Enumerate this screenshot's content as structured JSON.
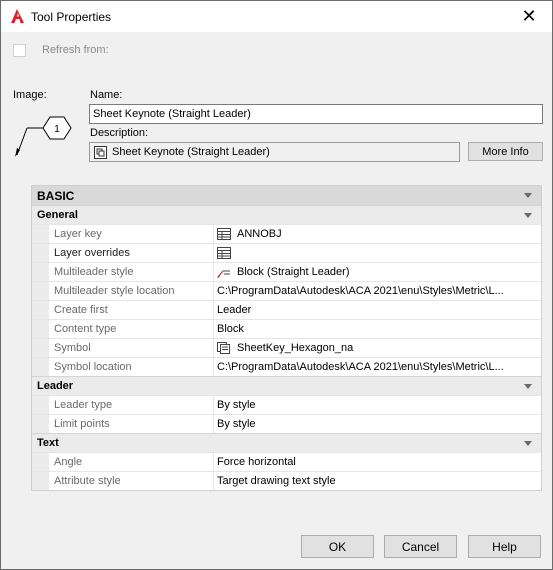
{
  "window": {
    "title": "Tool Properties",
    "close_glyph": "✕"
  },
  "refresh": {
    "label": "Refresh from:",
    "checked": false
  },
  "image": {
    "label": "Image:",
    "keynote_number": "1"
  },
  "name": {
    "label": "Name:",
    "value": "Sheet Keynote (Straight Leader)"
  },
  "description": {
    "label": "Description:",
    "value": "Sheet Keynote (Straight Leader)"
  },
  "more_info_label": "More Info",
  "grid": {
    "basic_label": "BASIC",
    "general": {
      "label": "General",
      "rows": [
        {
          "name": "Layer key",
          "value": "ANNOBJ",
          "icon": "table-icon"
        },
        {
          "name": "Layer overrides",
          "value": "",
          "icon": "table-icon"
        },
        {
          "name": "Multileader style",
          "value": "Block (Straight Leader)",
          "icon": "multileader-icon"
        },
        {
          "name": "Multileader style location",
          "value": "C:\\ProgramData\\Autodesk\\ACA  2021\\enu\\Styles\\Metric\\L..."
        },
        {
          "name": "Create first",
          "value": "Leader"
        },
        {
          "name": "Content type",
          "value": "Block"
        },
        {
          "name": "Symbol",
          "value": "SheetKey_Hexagon_na",
          "icon": "block-icon"
        },
        {
          "name": "Symbol location",
          "value": "C:\\ProgramData\\Autodesk\\ACA  2021\\enu\\Styles\\Metric\\L..."
        }
      ]
    },
    "leader": {
      "label": "Leader",
      "rows": [
        {
          "name": "Leader type",
          "value": "By style"
        },
        {
          "name": "Limit points",
          "value": "By style"
        }
      ]
    },
    "text": {
      "label": "Text",
      "rows": [
        {
          "name": "Angle",
          "value": "Force horizontal"
        },
        {
          "name": "Attribute style",
          "value": "Target drawing text style"
        }
      ]
    }
  },
  "buttons": {
    "ok": "OK",
    "cancel": "Cancel",
    "help": "Help"
  },
  "colors": {
    "app_icon": "#d8232a"
  }
}
